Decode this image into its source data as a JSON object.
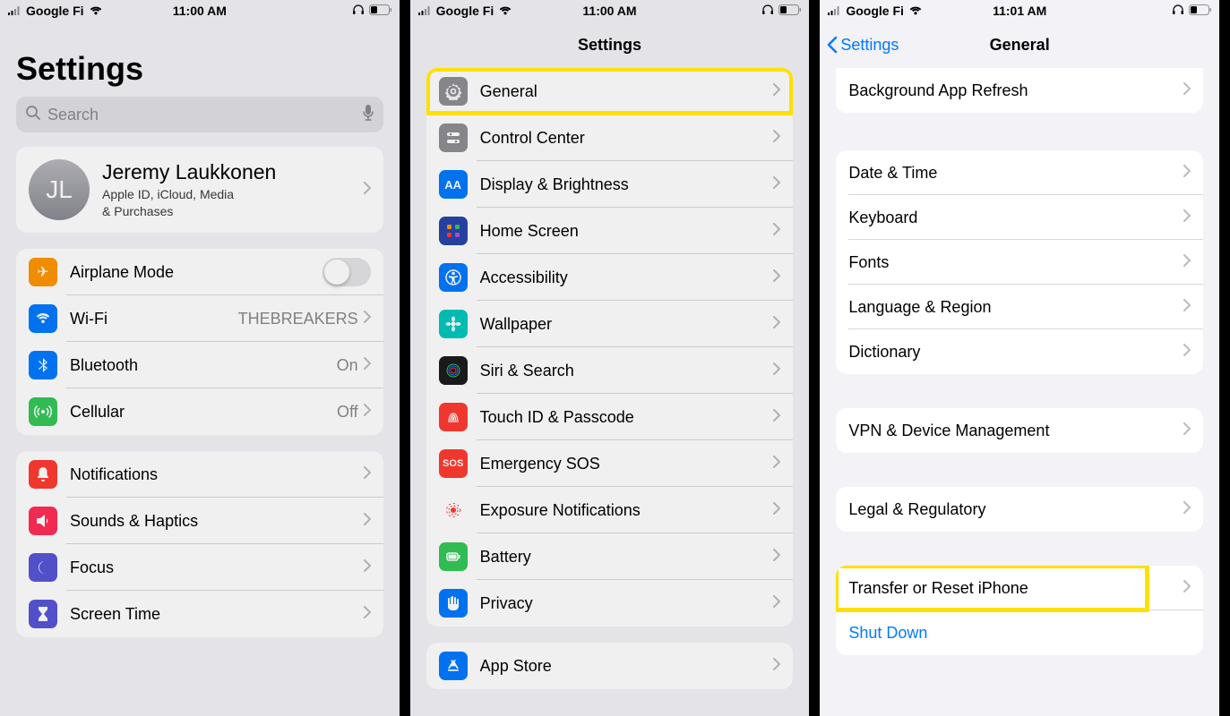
{
  "phone1": {
    "status": {
      "carrier": "Google Fi",
      "time": "11:00 AM"
    },
    "title": "Settings",
    "search_placeholder": "Search",
    "account": {
      "initials": "JL",
      "name": "Jeremy Laukkonen",
      "sub1": "Apple ID, iCloud, Media",
      "sub2": "& Purchases"
    },
    "group1": [
      {
        "label": "Airplane Mode",
        "type": "toggle"
      },
      {
        "label": "Wi-Fi",
        "value": "THEBREAKERS"
      },
      {
        "label": "Bluetooth",
        "value": "On"
      },
      {
        "label": "Cellular",
        "value": "Off"
      }
    ],
    "group2": [
      {
        "label": "Notifications"
      },
      {
        "label": "Sounds & Haptics"
      },
      {
        "label": "Focus"
      },
      {
        "label": "Screen Time"
      }
    ]
  },
  "phone2": {
    "status": {
      "carrier": "Google Fi",
      "time": "11:00 AM"
    },
    "nav_title": "Settings",
    "group1": [
      {
        "label": "General",
        "highlighted": true
      },
      {
        "label": "Control Center"
      },
      {
        "label": "Display & Brightness"
      },
      {
        "label": "Home Screen"
      },
      {
        "label": "Accessibility"
      },
      {
        "label": "Wallpaper"
      },
      {
        "label": "Siri & Search"
      },
      {
        "label": "Touch ID & Passcode"
      },
      {
        "label": "Emergency SOS"
      },
      {
        "label": "Exposure Notifications"
      },
      {
        "label": "Battery"
      },
      {
        "label": "Privacy"
      }
    ],
    "group2": [
      {
        "label": "App Store"
      }
    ]
  },
  "phone3": {
    "status": {
      "carrier": "Google Fi",
      "time": "11:01 AM"
    },
    "nav_back": "Settings",
    "nav_title": "General",
    "group1": [
      {
        "label": "Background App Refresh"
      }
    ],
    "group2": [
      {
        "label": "Date & Time"
      },
      {
        "label": "Keyboard"
      },
      {
        "label": "Fonts"
      },
      {
        "label": "Language & Region"
      },
      {
        "label": "Dictionary"
      }
    ],
    "group3": [
      {
        "label": "VPN & Device Management"
      }
    ],
    "group4": [
      {
        "label": "Legal & Regulatory"
      }
    ],
    "group5": [
      {
        "label": "Transfer or Reset iPhone",
        "highlighted": true
      },
      {
        "label": "Shut Down",
        "link": true
      }
    ]
  }
}
